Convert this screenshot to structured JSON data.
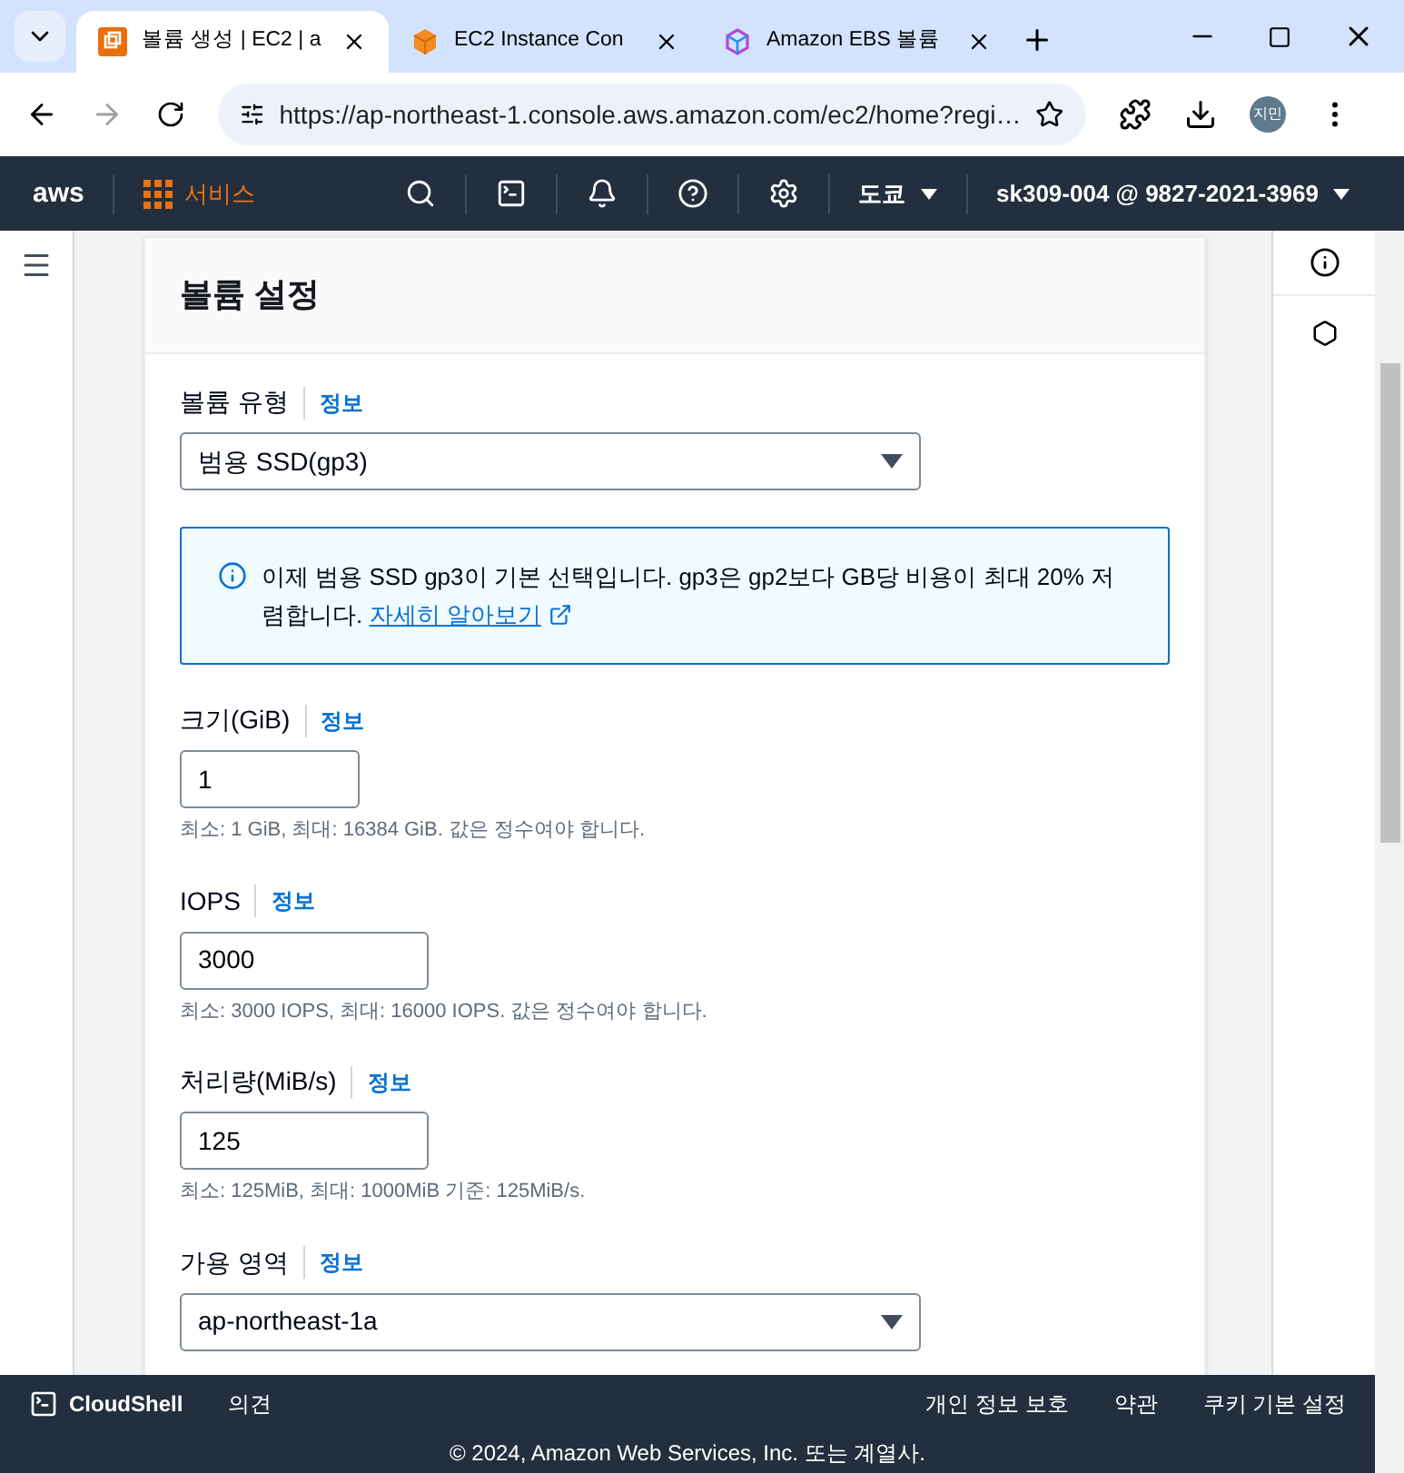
{
  "browser": {
    "tabs": [
      {
        "title": "볼륨 생성 | EC2 | a",
        "selected": true,
        "kind": "ec2"
      },
      {
        "title": "EC2 Instance Con",
        "selected": false,
        "kind": "cube"
      },
      {
        "title": "Amazon EBS 볼륨",
        "selected": false,
        "kind": "box"
      }
    ],
    "url": "https://ap-northeast-1.console.aws.amazon.com/ec2/home?regi…",
    "profile": "지민"
  },
  "nav": {
    "logo": "aws",
    "services": "서비스",
    "region": "도쿄",
    "account": "sk309-004 @ 9827-2021-3969"
  },
  "panel": {
    "title": "볼륨 설정",
    "volume_type": {
      "label": "볼륨 유형",
      "info": "정보",
      "value": "범용 SSD(gp3)"
    },
    "notice": {
      "text": "이제 범용 SSD gp3이 기본 선택입니다. gp3은 gp2보다 GB당 비용이 최대 20% 저렴합니다.",
      "link": "자세히 알아보기"
    },
    "fields": [
      {
        "label": "크기(GiB)",
        "info": "정보",
        "value": "1",
        "hint": "최소: 1 GiB, 최대: 16384 GiB. 값은 정수여야 합니다."
      },
      {
        "label": "IOPS",
        "info": "정보",
        "value": "3000",
        "hint": "최소: 3000 IOPS, 최대: 16000 IOPS. 값은 정수여야 합니다."
      },
      {
        "label": "처리량(MiB/s)",
        "info": "정보",
        "value": "125",
        "hint": "최소: 125MiB, 최대: 1000MiB 기준: 125MiB/s."
      }
    ],
    "zone": {
      "label": "가용 영역",
      "info": "정보",
      "value": "ap-northeast-1a"
    }
  },
  "footer": {
    "cloudshell": "CloudShell",
    "feedback": "의견",
    "links": [
      "개인 정보 보호",
      "약관",
      "쿠키 기본 설정"
    ],
    "copyright": "© 2024, Amazon Web Services, Inc. 또는 계열사."
  }
}
